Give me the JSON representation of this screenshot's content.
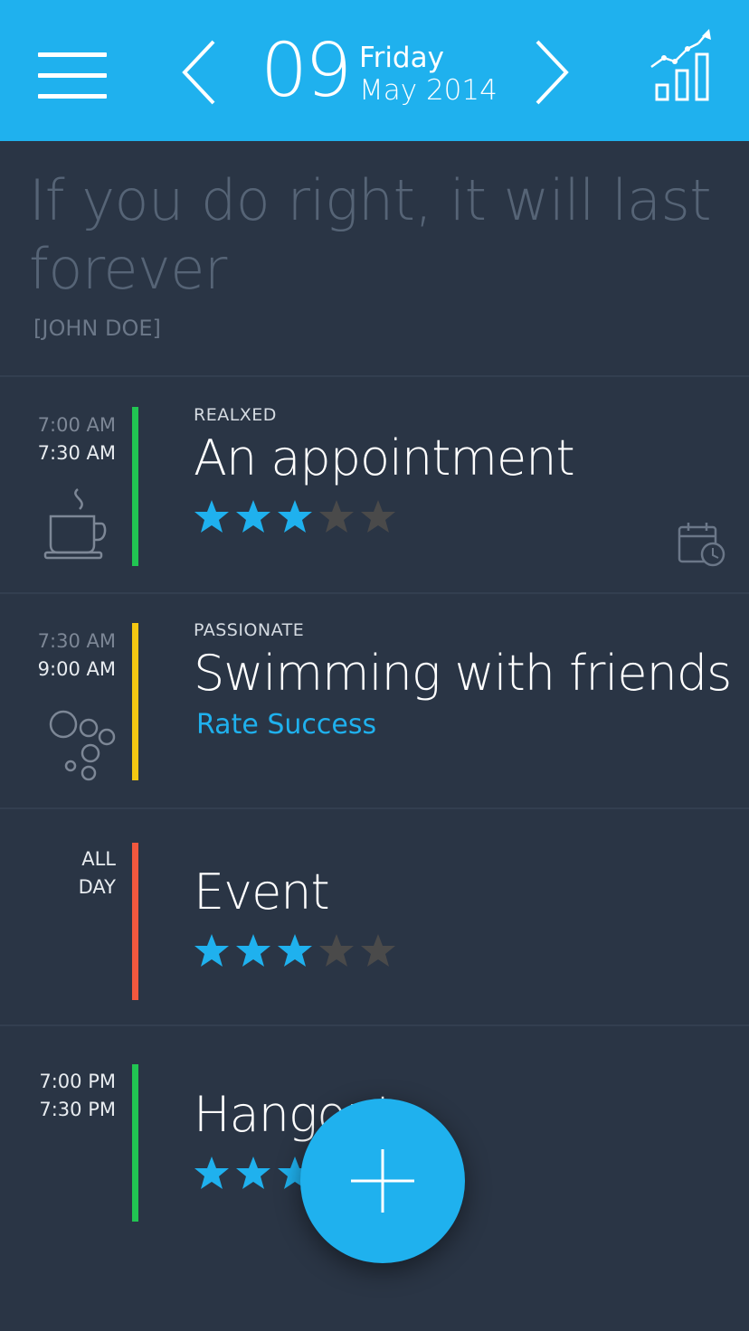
{
  "header": {
    "day": "09",
    "weekday": "Friday",
    "month_year": "May 2014",
    "menu_icon": "hamburger-menu-icon",
    "prev_icon": "chevron-left-icon",
    "next_icon": "chevron-right-icon",
    "stats_icon": "bar-chart-trend-icon"
  },
  "quote": {
    "text": "If you do right, it will last forever",
    "author": "[JOHN DOE]"
  },
  "events": [
    {
      "start": "7:00 AM",
      "end": "7:30 AM",
      "mood": "REALXED",
      "title": "An appointment",
      "rating": 3,
      "max_rating": 5,
      "color": "#21c552",
      "icon": "coffee-cup-icon",
      "extra_icon": "calendar-clock-icon"
    },
    {
      "start": "7:30 AM",
      "end": "9:00 AM",
      "mood": "PASSIONATE",
      "title": "Swimming with friends",
      "action": "Rate Success",
      "color": "#f4c712",
      "icon": "bubbles-icon"
    },
    {
      "all_day_1": "ALL",
      "all_day_2": "DAY",
      "title": "Event",
      "rating": 3,
      "max_rating": 5,
      "color": "#f2583e"
    },
    {
      "start": "7:00 PM",
      "end": "7:30 PM",
      "title": "Hangout",
      "rating": 3,
      "max_rating": 5,
      "color": "#21c552"
    }
  ],
  "fab": {
    "icon": "plus-icon",
    "label": "Add event"
  },
  "colors": {
    "accent": "#1fb1ee",
    "background": "#2a3545",
    "star_on": "#1fb1ee",
    "star_off": "#4a4a4a"
  }
}
